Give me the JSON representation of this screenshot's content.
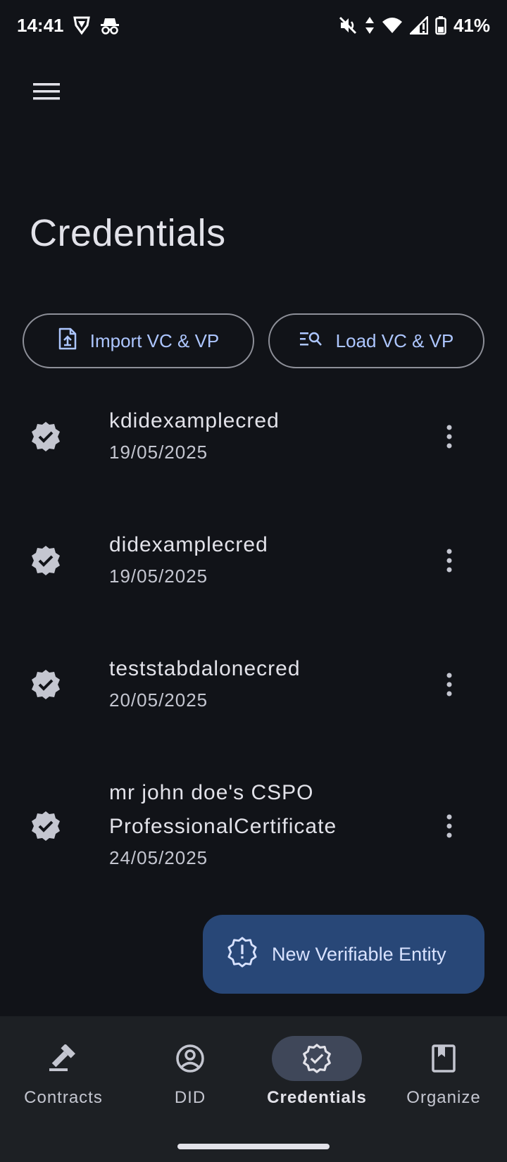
{
  "status_bar": {
    "time": "14:41",
    "battery": "41%",
    "icons": [
      "shield-icon",
      "incognito-icon",
      "mute-icon",
      "data-arrows-icon",
      "wifi-icon",
      "signal-icon",
      "battery-icon"
    ]
  },
  "app_bar": {
    "menu_icon": "hamburger-menu-icon"
  },
  "page": {
    "title": "Credentials"
  },
  "actions": {
    "import_label": "Import VC & VP",
    "load_label": "Load VC & VP"
  },
  "credentials": [
    {
      "name": "kdidexamplecred",
      "date": "19/05/2025"
    },
    {
      "name": "didexamplecred",
      "date": "19/05/2025"
    },
    {
      "name": "teststabdalonecred",
      "date": "20/05/2025"
    },
    {
      "name_line1": "mr john doe's CSPO",
      "name_line2": "ProfessionalCertificate",
      "date": "24/05/2025"
    }
  ],
  "fab": {
    "label": "New Verifiable Entity"
  },
  "bottom_nav": {
    "items": [
      {
        "label": "Contracts",
        "icon": "gavel-icon"
      },
      {
        "label": "DID",
        "icon": "account-circle-icon"
      },
      {
        "label": "Credentials",
        "icon": "verified-badge-icon",
        "active": true
      },
      {
        "label": "Organize",
        "icon": "bookmark-book-icon"
      }
    ]
  },
  "colors": {
    "background": "#111318",
    "accent": "#adc6ff",
    "fab_bg": "#284777",
    "nav_bg": "#1d2024",
    "nav_active": "#3f4759"
  }
}
